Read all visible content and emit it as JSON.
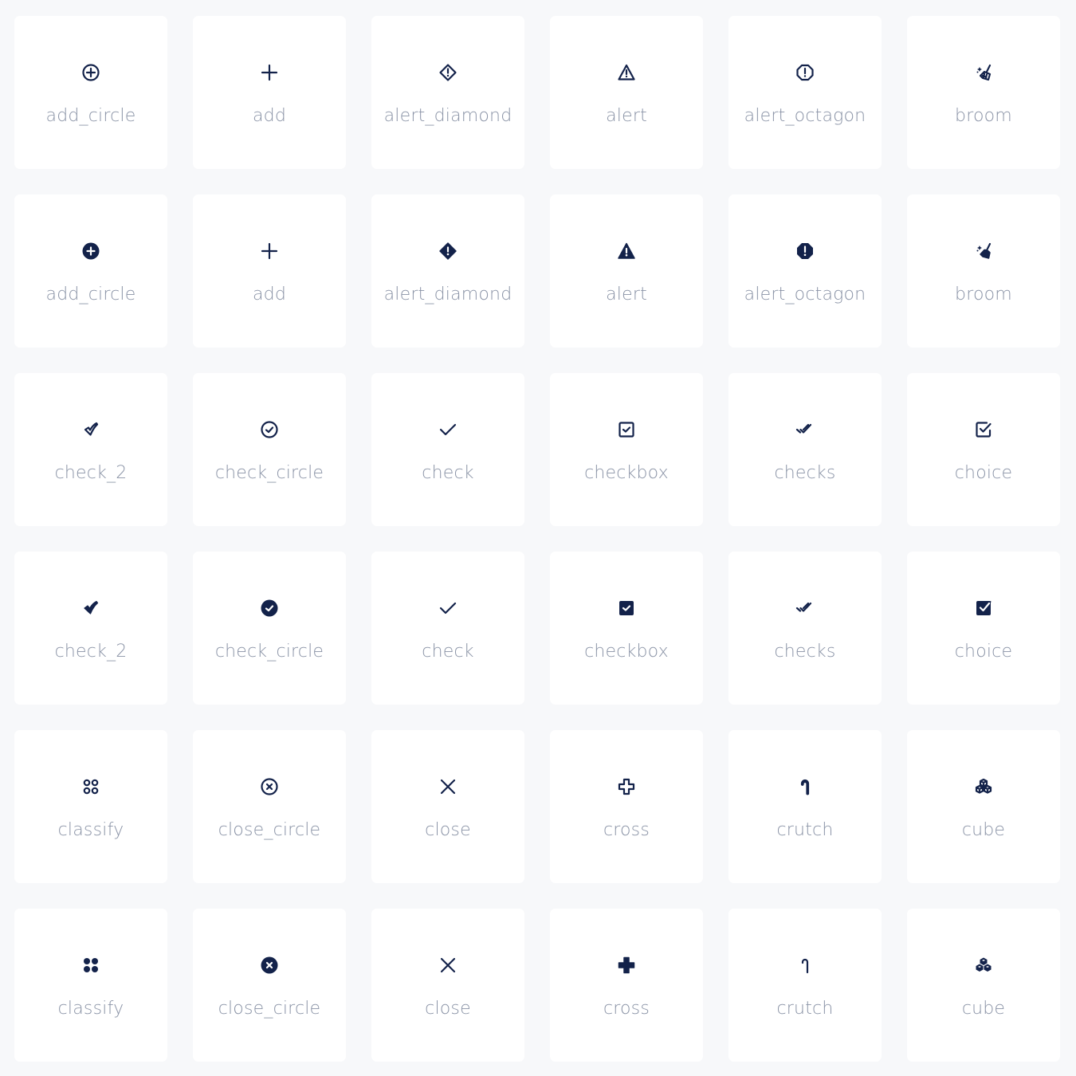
{
  "colors": {
    "icon": "#13224a",
    "label": "#8a93a6",
    "card": "#ffffff",
    "background": "#f7f8fa"
  },
  "rows": [
    {
      "style": "outline",
      "items": [
        {
          "label": "add_circle",
          "icon": "add_circle"
        },
        {
          "label": "add",
          "icon": "add"
        },
        {
          "label": "alert_diamond",
          "icon": "alert_diamond"
        },
        {
          "label": "alert",
          "icon": "alert"
        },
        {
          "label": "alert_octagon",
          "icon": "alert_octagon"
        },
        {
          "label": "broom",
          "icon": "broom"
        }
      ]
    },
    {
      "style": "filled",
      "items": [
        {
          "label": "add_circle",
          "icon": "add_circle"
        },
        {
          "label": "add",
          "icon": "add"
        },
        {
          "label": "alert_diamond",
          "icon": "alert_diamond"
        },
        {
          "label": "alert",
          "icon": "alert"
        },
        {
          "label": "alert_octagon",
          "icon": "alert_octagon"
        },
        {
          "label": "broom",
          "icon": "broom"
        }
      ]
    },
    {
      "style": "outline",
      "items": [
        {
          "label": "check_2",
          "icon": "check_2"
        },
        {
          "label": "check_circle",
          "icon": "check_circle"
        },
        {
          "label": "check",
          "icon": "check"
        },
        {
          "label": "checkbox",
          "icon": "checkbox"
        },
        {
          "label": "checks",
          "icon": "checks"
        },
        {
          "label": "choice",
          "icon": "choice"
        }
      ]
    },
    {
      "style": "filled",
      "items": [
        {
          "label": "check_2",
          "icon": "check_2"
        },
        {
          "label": "check_circle",
          "icon": "check_circle"
        },
        {
          "label": "check",
          "icon": "check"
        },
        {
          "label": "checkbox",
          "icon": "checkbox"
        },
        {
          "label": "checks",
          "icon": "checks"
        },
        {
          "label": "choice",
          "icon": "choice"
        }
      ]
    },
    {
      "style": "outline",
      "items": [
        {
          "label": "classify",
          "icon": "classify"
        },
        {
          "label": "close_circle",
          "icon": "close_circle"
        },
        {
          "label": "close",
          "icon": "close"
        },
        {
          "label": "cross",
          "icon": "cross"
        },
        {
          "label": "crutch",
          "icon": "crutch"
        },
        {
          "label": "cube",
          "icon": "cube"
        }
      ]
    },
    {
      "style": "filled",
      "items": [
        {
          "label": "classify",
          "icon": "classify"
        },
        {
          "label": "close_circle",
          "icon": "close_circle"
        },
        {
          "label": "close",
          "icon": "close"
        },
        {
          "label": "cross",
          "icon": "cross"
        },
        {
          "label": "crutch",
          "icon": "crutch"
        },
        {
          "label": "cube",
          "icon": "cube"
        }
      ]
    }
  ]
}
